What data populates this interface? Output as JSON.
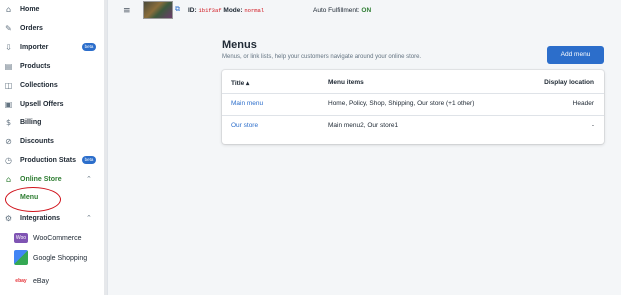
{
  "sidebar": {
    "items": [
      {
        "icon": "home-icon",
        "label": "Home"
      },
      {
        "icon": "orders-icon",
        "label": "Orders"
      },
      {
        "icon": "importer-icon",
        "label": "Importer",
        "badge": "beta"
      },
      {
        "icon": "products-icon",
        "label": "Products"
      },
      {
        "icon": "collections-icon",
        "label": "Collections"
      },
      {
        "icon": "upsell-icon",
        "label": "Upsell Offers"
      },
      {
        "icon": "billing-icon",
        "label": "Billing"
      },
      {
        "icon": "discounts-icon",
        "label": "Discounts"
      },
      {
        "icon": "stats-icon",
        "label": "Production Stats",
        "badge": "beta"
      },
      {
        "icon": "store-icon",
        "label": "Online Store"
      }
    ],
    "online_store_sub": "Menu",
    "integrations_label": "Integrations",
    "integrations": [
      {
        "icon": "woocommerce-icon",
        "label": "WooCommerce",
        "logo_text": "Woo"
      },
      {
        "icon": "google-shopping-icon",
        "label": "Google Shopping",
        "logo_text": ""
      },
      {
        "icon": "ebay-icon",
        "label": "eBay",
        "logo_text": "ebay"
      }
    ]
  },
  "topbar": {
    "id_label": "ID:",
    "id_value": "1b1f3af",
    "mode_label": "Mode:",
    "mode_value": "normal",
    "auto_label": "Auto Fulfillment:",
    "auto_value": "ON"
  },
  "page": {
    "title": "Menus",
    "subtitle": "Menus, or link lists, help your customers navigate around your online store.",
    "add_button": "Add menu"
  },
  "table": {
    "headers": [
      "Title ▴",
      "Menu items",
      "Display location"
    ],
    "rows": [
      {
        "title": "Main menu",
        "items": "Home, Policy, Shop, Shipping, Our store (+1 other)",
        "location": "Header"
      },
      {
        "title": "Our store",
        "items": "Main menu2, Our store1",
        "location": "-"
      }
    ]
  },
  "colors": {
    "accent": "#2c6ecb",
    "active": "#2e7d32",
    "highlight_ring": "#d0121b"
  }
}
